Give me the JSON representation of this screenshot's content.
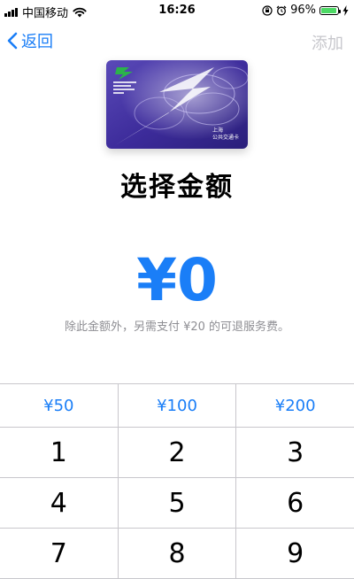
{
  "status_bar": {
    "carrier": "中国移动",
    "time": "16:26",
    "battery_percent_text": "96%",
    "battery_level": 0.96,
    "signal_bars": 4
  },
  "nav": {
    "back_label": "返回",
    "add_label": "添加"
  },
  "card": {
    "caption_line1": "上海",
    "caption_line2": "公共交通卡"
  },
  "title": "选择金额",
  "amount": "¥0",
  "note": "除此金额外，另需支付 ¥20 的可退服务费。",
  "presets": [
    "¥50",
    "¥100",
    "¥200"
  ],
  "digit_rows": [
    [
      "1",
      "2",
      "3"
    ],
    [
      "4",
      "5",
      "6"
    ],
    [
      "7",
      "8",
      "9"
    ]
  ],
  "colors": {
    "accent": "#1a7ef7",
    "disabled": "#c7c7cc",
    "note": "#8e8e93",
    "card_purple": "#3c2b9a",
    "battery_green": "#4cd964"
  }
}
